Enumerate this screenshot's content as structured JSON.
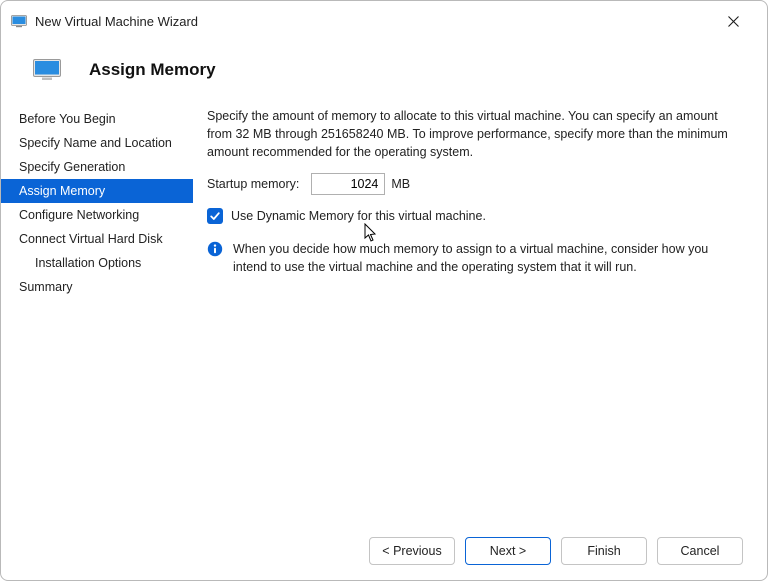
{
  "window": {
    "title": "New Virtual Machine Wizard"
  },
  "header": {
    "title": "Assign Memory"
  },
  "sidebar": {
    "steps": [
      {
        "label": "Before You Begin",
        "selected": false,
        "indent": false
      },
      {
        "label": "Specify Name and Location",
        "selected": false,
        "indent": false
      },
      {
        "label": "Specify Generation",
        "selected": false,
        "indent": false
      },
      {
        "label": "Assign Memory",
        "selected": true,
        "indent": false
      },
      {
        "label": "Configure Networking",
        "selected": false,
        "indent": false
      },
      {
        "label": "Connect Virtual Hard Disk",
        "selected": false,
        "indent": false
      },
      {
        "label": "Installation Options",
        "selected": false,
        "indent": true
      },
      {
        "label": "Summary",
        "selected": false,
        "indent": false
      }
    ]
  },
  "content": {
    "description": "Specify the amount of memory to allocate to this virtual machine. You can specify an amount from 32 MB through 251658240 MB. To improve performance, specify more than the minimum amount recommended for the operating system.",
    "startup_label": "Startup memory:",
    "startup_value": "1024",
    "startup_unit": "MB",
    "dynamic_checked": true,
    "dynamic_label": "Use Dynamic Memory for this virtual machine.",
    "info_text": "When you decide how much memory to assign to a virtual machine, consider how you intend to use the virtual machine and the operating system that it will run."
  },
  "footer": {
    "previous": "< Previous",
    "next": "Next >",
    "finish": "Finish",
    "cancel": "Cancel"
  },
  "colors": {
    "accent": "#0a64d6"
  }
}
